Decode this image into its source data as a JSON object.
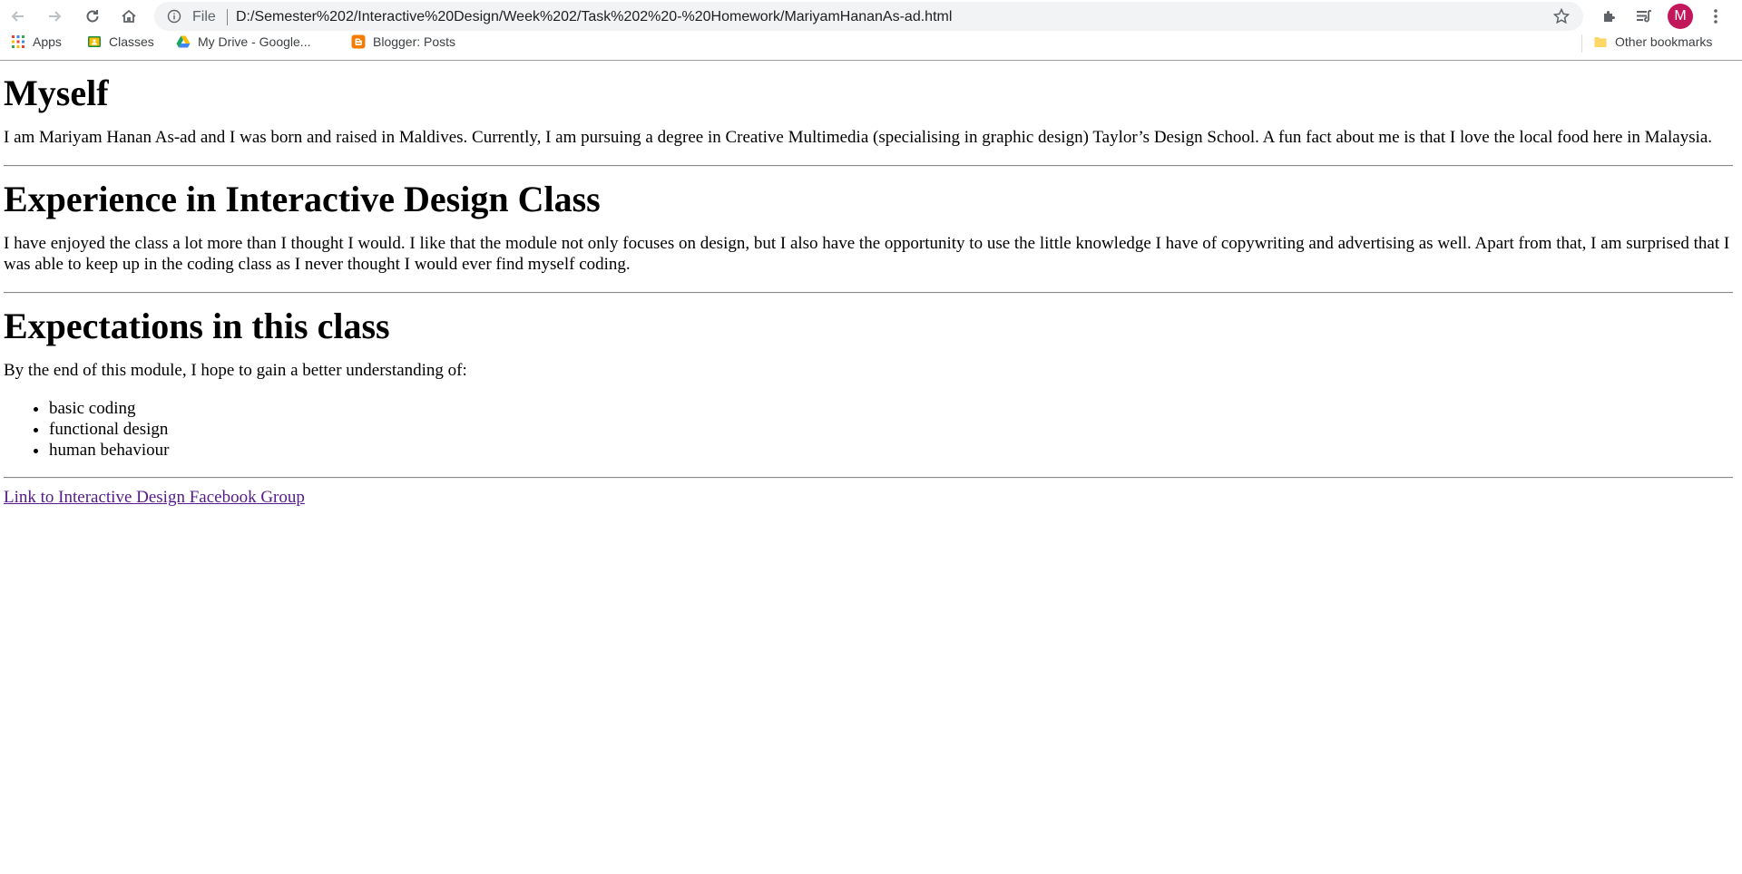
{
  "browser": {
    "file_label": "File",
    "url": "D:/Semester%202/Interactive%20Design/Week%202/Task%202%20-%20Homework/MariyamHananAs-ad.html",
    "avatar_letter": "M",
    "avatar_color": "#c2185b",
    "bookmarks": [
      {
        "label": "Apps",
        "icon": "apps-grid-icon"
      },
      {
        "label": "Classes",
        "icon": "google-classroom-icon"
      },
      {
        "label": "My Drive - Google...",
        "icon": "google-drive-icon"
      },
      {
        "label": "Blogger: Posts",
        "icon": "blogger-icon"
      }
    ],
    "other_bookmarks": "Other bookmarks"
  },
  "page": {
    "sections": [
      {
        "heading": "Myself",
        "text": "I am Mariyam Hanan As-ad and I was born and raised in Maldives. Currently, I am pursuing a degree in Creative Multimedia (specialising in graphic design) Taylor’s Design School. A fun fact about me is that I love the local food here in Malaysia."
      },
      {
        "heading": "Experience in Interactive Design Class",
        "text": "I have enjoyed the class a lot more than I thought I would. I like that the module not only focuses on design, but I also have the opportunity to use the little knowledge I have of copywriting and advertising as well. Apart from that, I am surprised that I was able to keep up in the coding class as I never thought I would ever find myself coding."
      },
      {
        "heading": "Expectations in this class",
        "text": "By the end of this module, I hope to gain a better understanding of:",
        "list": [
          "basic coding",
          "functional design",
          "human behaviour"
        ]
      }
    ],
    "link_text": "Link to Interactive Design Facebook Group",
    "link_color": "#551a8b"
  }
}
